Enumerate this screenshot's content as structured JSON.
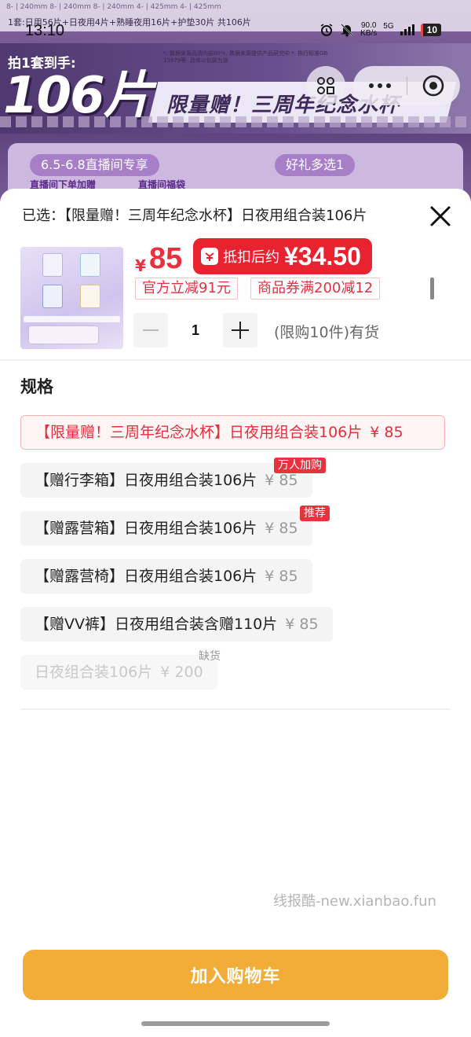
{
  "status_bar": {
    "time": "13:10",
    "net_speed": "90.0",
    "net_unit": "KB/s",
    "net_type": "5G",
    "battery": "10"
  },
  "background_banner": {
    "table_row": "8-  |  240mm       8-  |  240mm       8-  |  240mm       4-  |  425mm       4-  |  425mm",
    "summary": "1套:日用56片+日夜用4片+熟睡夜用16片+护垫30片 共106片",
    "fine_print": "*. 数据来源品牌内部80%, 数据来源提供产品研究中\n*. 执行标准GB 15979等, 具体以包装为准",
    "buy_label": "拍1套到手:",
    "big_number": "106片",
    "slogan": "限量赠！三周年纪念水杯",
    "pill_1": "6.5-6.8直播间专享",
    "pill_2": "好礼多选1",
    "sub_1": "直播间下单加赠",
    "sub_2": "直播间福袋"
  },
  "sheet": {
    "selected_prefix": "已选：",
    "selected_text": "【限量赠！三周年纪念水杯】日夜用组合装106片",
    "price_symbol": "¥",
    "price": "85",
    "after_discount_label": "抵扣后约",
    "after_discount_price": "¥34.50",
    "promo_tags": [
      "官方立减91元",
      "商品券满200减12"
    ],
    "quantity": "1",
    "stock_text": "(限购10件)有货",
    "spec_title": "规格",
    "options": [
      {
        "label": "【限量赠！三周年纪念水杯】日夜用组合装106片",
        "price": "¥ 85",
        "badge": ""
      },
      {
        "label": "【赠行李箱】日夜用组合装106片",
        "price": "¥ 85",
        "badge": "万人加购"
      },
      {
        "label": "【赠露营箱】日夜用组合装106片",
        "price": "¥ 85",
        "badge": "推荐"
      },
      {
        "label": "【赠露营椅】日夜用组合装106片",
        "price": "¥ 85",
        "badge": ""
      },
      {
        "label": "【赠VV裤】日夜用组合装含赠110片",
        "price": "¥ 85",
        "badge": ""
      },
      {
        "label": "日夜组合装106片",
        "price": "¥ 200",
        "badge": "缺货"
      }
    ],
    "watermark": "线报酷-new.xianbao.fun",
    "add_to_cart": "加入购物车"
  },
  "icons": {
    "close": "close-icon",
    "minus": "minus-icon",
    "plus": "plus-icon",
    "scan": "scan-icon",
    "more": "more-dots-icon",
    "target": "target-icon",
    "coupon": "coupon-icon"
  },
  "colors": {
    "accent_red": "#e8222f",
    "cart_button": "#f2ad38",
    "banner_purple": "#5a3e7a"
  }
}
